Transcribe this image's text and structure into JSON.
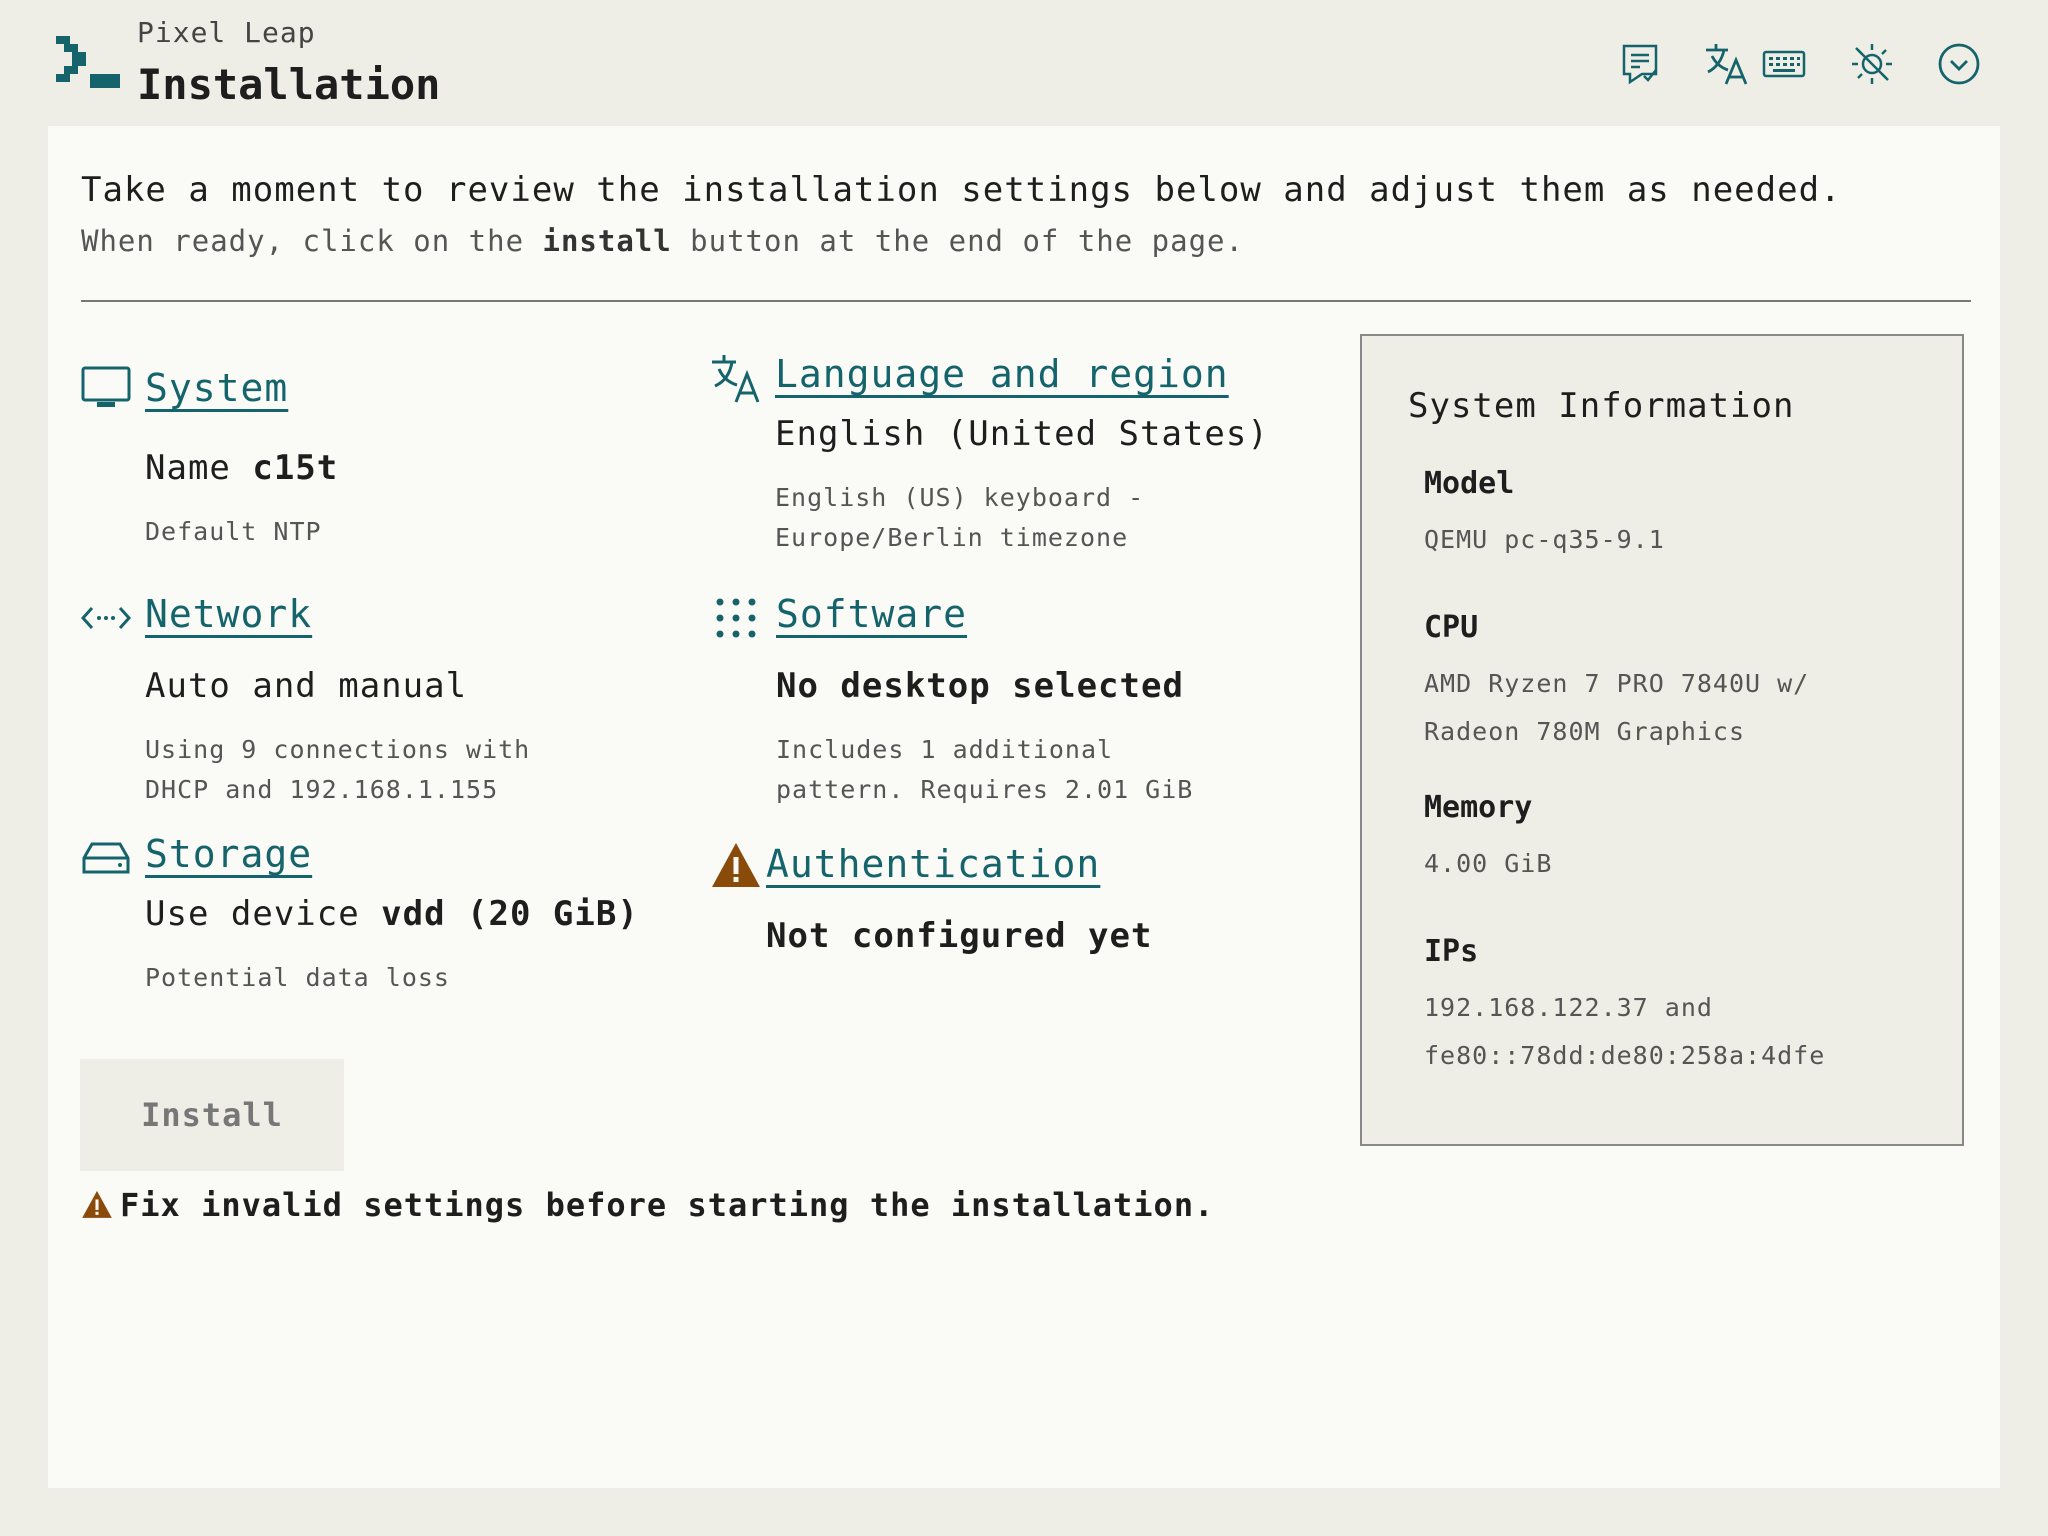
{
  "header": {
    "brand": "Pixel Leap",
    "title": "Installation",
    "icons": [
      "review-icon",
      "language-icon",
      "keyboard-icon",
      "theme-icon",
      "menu-chevron-icon"
    ]
  },
  "intro": {
    "line1": "Take a moment to review the installation settings below and adjust them as needed.",
    "line2_before": "When ready, click on the ",
    "line2_bold": "install",
    "line2_after": " button at the end of the page."
  },
  "sections": {
    "system": {
      "heading": "System",
      "value_prefix": "Name ",
      "value_bold": "c15t",
      "desc": "Default NTP"
    },
    "network": {
      "heading": "Network",
      "value": "Auto and manual",
      "desc1": "Using 9 connections with",
      "desc2": "DHCP and 192.168.1.155"
    },
    "storage": {
      "heading": "Storage",
      "value_prefix": "Use device ",
      "value_bold": "vdd (20 GiB)",
      "desc": "Potential data loss"
    },
    "language": {
      "heading": "Language and region",
      "value": "English (United States)",
      "desc1": "English (US) keyboard -",
      "desc2": "Europe/Berlin timezone"
    },
    "software": {
      "heading": "Software",
      "value": "No desktop selected",
      "desc1": "Includes 1 additional",
      "desc2": "pattern. Requires 2.01 GiB"
    },
    "authentication": {
      "heading": "Authentication",
      "value": "Not configured yet"
    }
  },
  "system_info": {
    "title": "System Information",
    "model_label": "Model",
    "model_value": "QEMU pc-q35-9.1",
    "cpu_label": "CPU",
    "cpu_value1": "AMD Ryzen 7 PRO 7840U w/",
    "cpu_value2": "Radeon 780M Graphics",
    "memory_label": "Memory",
    "memory_value": "4.00 GiB",
    "ips_label": "IPs",
    "ips_value1": "192.168.122.37 and",
    "ips_value2": "fe80::78dd:de80:258a:4dfe"
  },
  "install": {
    "button_label": "Install",
    "warning": "Fix invalid settings before starting the installation."
  },
  "colors": {
    "accent": "#15646b",
    "warning": "#8a4a0a",
    "page_background": "#eeede6",
    "panel_background": "#fafaf7"
  }
}
